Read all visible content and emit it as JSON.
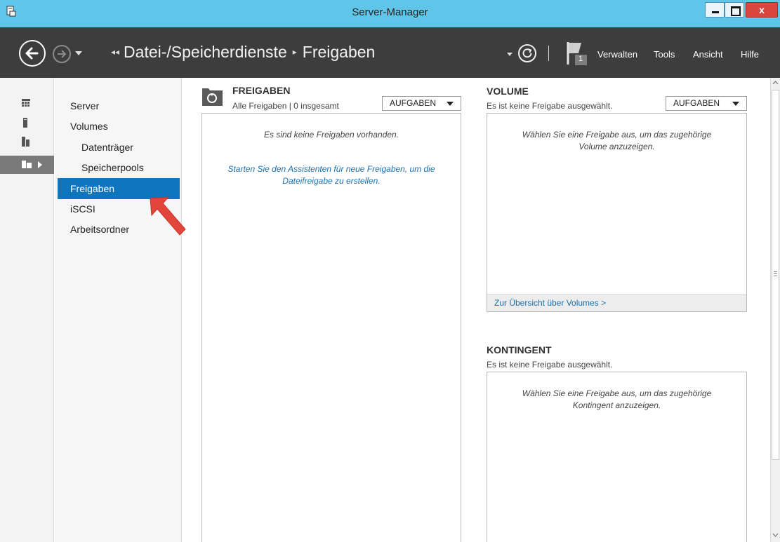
{
  "window": {
    "title": "Server-Manager",
    "close_label": "x"
  },
  "header": {
    "breadcrumb_lead": "◂◂",
    "breadcrumb_parent": "Datei-/Speicherdienste",
    "breadcrumb_separator": "▸",
    "breadcrumb_current": "Freigaben",
    "notification_count": "1",
    "menus": [
      "Verwalten",
      "Tools",
      "Ansicht",
      "Hilfe"
    ],
    "colors": {
      "titlebar": "#5fc6e9",
      "header": "#3d3d3d",
      "selection": "#0f75bd"
    }
  },
  "rail": {
    "items": [
      "dashboard-icon",
      "local-server-icon",
      "all-servers-icon",
      "file-storage-services-icon"
    ],
    "selected": "file-storage-services-icon"
  },
  "subnav": {
    "items": [
      {
        "label": "Server",
        "level": 0
      },
      {
        "label": "Volumes",
        "level": 0
      },
      {
        "label": "Datenträger",
        "level": 1
      },
      {
        "label": "Speicherpools",
        "level": 1
      },
      {
        "label": "Freigaben",
        "level": 0,
        "selected": true
      },
      {
        "label": "iSCSI",
        "level": 0
      },
      {
        "label": "Arbeitsordner",
        "level": 0
      }
    ]
  },
  "freigaben": {
    "title": "FREIGABEN",
    "subtitle": "Alle Freigaben | 0 insgesamt",
    "tasks_label": "AUFGABEN",
    "empty_message": "Es sind keine Freigaben vorhanden.",
    "wizard_link": "Starten Sie den Assistenten für neue Freigaben, um die Dateifreigabe zu erstellen."
  },
  "volume": {
    "title": "VOLUME",
    "subtitle": "Es ist keine Freigabe ausgewählt.",
    "tasks_label": "AUFGABEN",
    "message": "Wählen Sie eine Freigabe aus, um das zugehörige Volume anzuzeigen.",
    "footer_link": "Zur Übersicht über Volumes >"
  },
  "kontingent": {
    "title": "KONTINGENT",
    "subtitle": "Es ist keine Freigabe ausgewählt.",
    "message": "Wählen Sie eine Freigabe aus, um das zugehörige Kontingent anzuzeigen."
  }
}
